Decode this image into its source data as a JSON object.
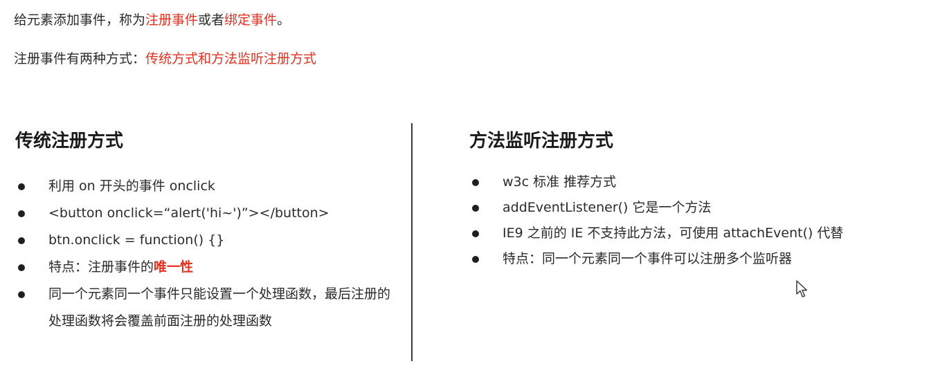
{
  "intro": {
    "line1": {
      "part1": "给元素添加事件，称为",
      "red1": "注册事件",
      "part2": "或者",
      "red2": "绑定事件",
      "part3": "。"
    },
    "line2": {
      "part1": "注册事件有两种方式：",
      "red": "传统方式和方法监听注册方式"
    }
  },
  "left": {
    "heading": "传统注册方式",
    "items": [
      "利用 on 开头的事件 onclick",
      "<button onclick=“alert('hi~')”></button>",
      "btn.onclick = function() {}",
      {
        "text": "特点：注册事件的",
        "emph": "唯一性"
      },
      "同一个元素同一个事件只能设置一个处理函数，最后注册的处理函数将会覆盖前面注册的处理函数"
    ]
  },
  "right": {
    "heading": "方法监听注册方式",
    "items": [
      "w3c 标准 推荐方式",
      "addEventListener() 它是一个方法",
      "IE9 之前的 IE 不支持此方法，可使用 attachEvent() 代替",
      "特点：同一个元素同一个事件可以注册多个监听器"
    ]
  },
  "colors": {
    "accent_red": "#e5301f",
    "text": "#2a2a2a",
    "divider": "#3a3a3a"
  },
  "icons": {
    "cursor": "mouse-pointer-icon",
    "bullet": "bullet-dot-icon"
  }
}
